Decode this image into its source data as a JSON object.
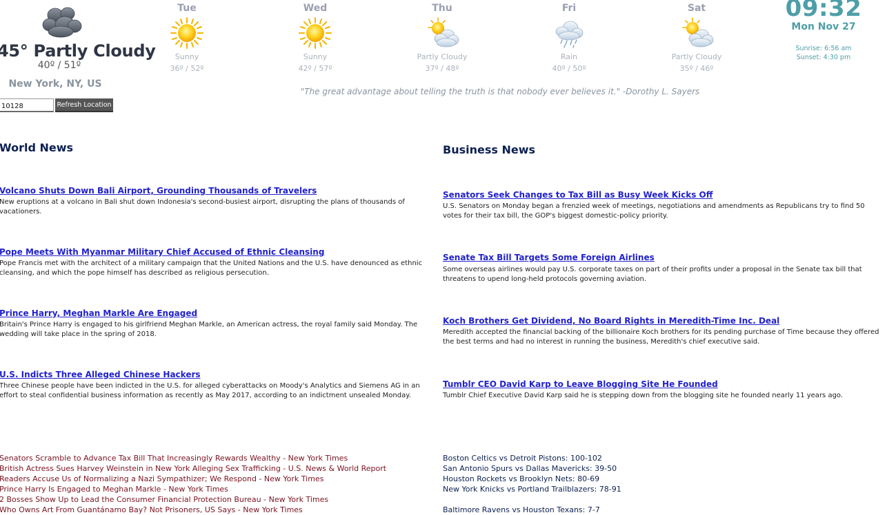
{
  "current": {
    "icon": "cloudy-icon",
    "temp": "45° Partly Cloudy",
    "range": "40º / 51º",
    "location": "New York, NY, US",
    "zip_value": "10128",
    "refresh_label": "Refresh Location"
  },
  "forecast": [
    {
      "day": "Tue",
      "icon": "sunny-icon",
      "desc": "Sunny",
      "range": "36º / 52º"
    },
    {
      "day": "Wed",
      "icon": "sunny-icon",
      "desc": "Sunny",
      "range": "42º / 57º"
    },
    {
      "day": "Thu",
      "icon": "partly-cloudy-icon",
      "desc": "Partly Cloudy",
      "range": "37º / 48º"
    },
    {
      "day": "Fri",
      "icon": "rain-icon",
      "desc": "Rain",
      "range": "40º / 50º"
    },
    {
      "day": "Sat",
      "icon": "partly-cloudy-icon",
      "desc": "Partly Cloudy",
      "range": "35º / 46º"
    }
  ],
  "clock": {
    "time": "09:32",
    "date": "Mon Nov 27",
    "sunrise": "Sunrise: 6:56 am",
    "sunset": "Sunset: 4:30 pm"
  },
  "quote": "\"The great advantage about telling the truth is that nobody ever believes it.\"  -Dorothy L. Sayers",
  "world_news": {
    "title": "World News",
    "items": [
      {
        "headline": "Volcano Shuts Down Bali Airport, Grounding Thousands of Travelers",
        "summary": "New eruptions at a volcano in Bali shut down Indonesia's second-busiest airport, disrupting the plans of thousands of vacationers."
      },
      {
        "headline": "Pope Meets With Myanmar Military Chief Accused of Ethnic Cleansing",
        "summary": "Pope Francis met with the architect of a military campaign that the United Nations and the U.S. have denounced as ethnic cleansing, and which the pope himself has described as religious persecution."
      },
      {
        "headline": "Prince Harry, Meghan Markle Are Engaged",
        "summary": "Britain's Prince Harry is engaged to his girlfriend Meghan Markle, an American actress, the royal family said Monday. The wedding will take place in the spring of 2018."
      },
      {
        "headline": "U.S. Indicts Three Alleged Chinese Hackers",
        "summary": "Three Chinese people have been indicted in the U.S. for alleged cyberattacks on Moody's Analytics and Siemens AG in an effort to steal confidential business information as recently as May 2017, according to an indictment unsealed Monday."
      }
    ]
  },
  "business_news": {
    "title": "Business News",
    "items": [
      {
        "headline": "Senators Seek Changes to Tax Bill as Busy Week Kicks Off",
        "summary": "U.S. Senators on Monday began a frenzied week of meetings, negotiations and amendments as Republicans try to find 50 votes for their tax bill, the GOP's biggest domestic-policy priority."
      },
      {
        "headline": "Senate Tax Bill Targets Some Foreign Airlines",
        "summary": "Some overseas airlines would pay U.S. corporate taxes on part of their profits under a proposal in the Senate tax bill that threatens to upend long-held protocols governing aviation."
      },
      {
        "headline": "Koch Brothers Get Dividend, No Board Rights in Meredith-Time Inc. Deal",
        "summary": "Meredith accepted the financial backing of the billionaire Koch brothers for its pending purchase of Time because they offered the best terms and had no interest in running the business, Meredith's chief executive said."
      },
      {
        "headline": "Tumblr CEO David Karp to Leave Blogging Site He Founded",
        "summary": "Tumblr Chief Executive David Karp said he is stepping down from the blogging site he founded nearly 11 years ago."
      }
    ]
  },
  "headlines": [
    "Senators Scramble to Advance Tax Bill That Increasingly Rewards Wealthy - New York Times",
    "British Actress Sues Harvey Weinstein in New York Alleging Sex Trafficking - U.S. News & World Report",
    "Readers Accuse Us of Normalizing a Nazi Sympathizer; We Respond - New York Times",
    "Prince Harry Is Engaged to Meghan Markle - New York Times",
    "2 Bosses Show Up to Lead the Consumer Financial Protection Bureau - New York Times",
    "Who Owns Art From Guantánamo Bay? Not Prisoners, US Says - New York Times"
  ],
  "scores_nba": [
    "Boston Celtics vs Detroit Pistons: 100-102",
    "San Antonio Spurs vs Dallas Mavericks: 39-50",
    "Houston Rockets vs Brooklyn Nets: 80-69",
    "New York Knicks vs Portland Trailblazers: 78-91"
  ],
  "scores_nfl": [
    "Baltimore Ravens vs Houston Texans: 7-7"
  ],
  "colors": {
    "accent": "#4e9ea8",
    "news_title": "#0c2050",
    "link": "#2222cc",
    "headline": "#7a1320"
  }
}
